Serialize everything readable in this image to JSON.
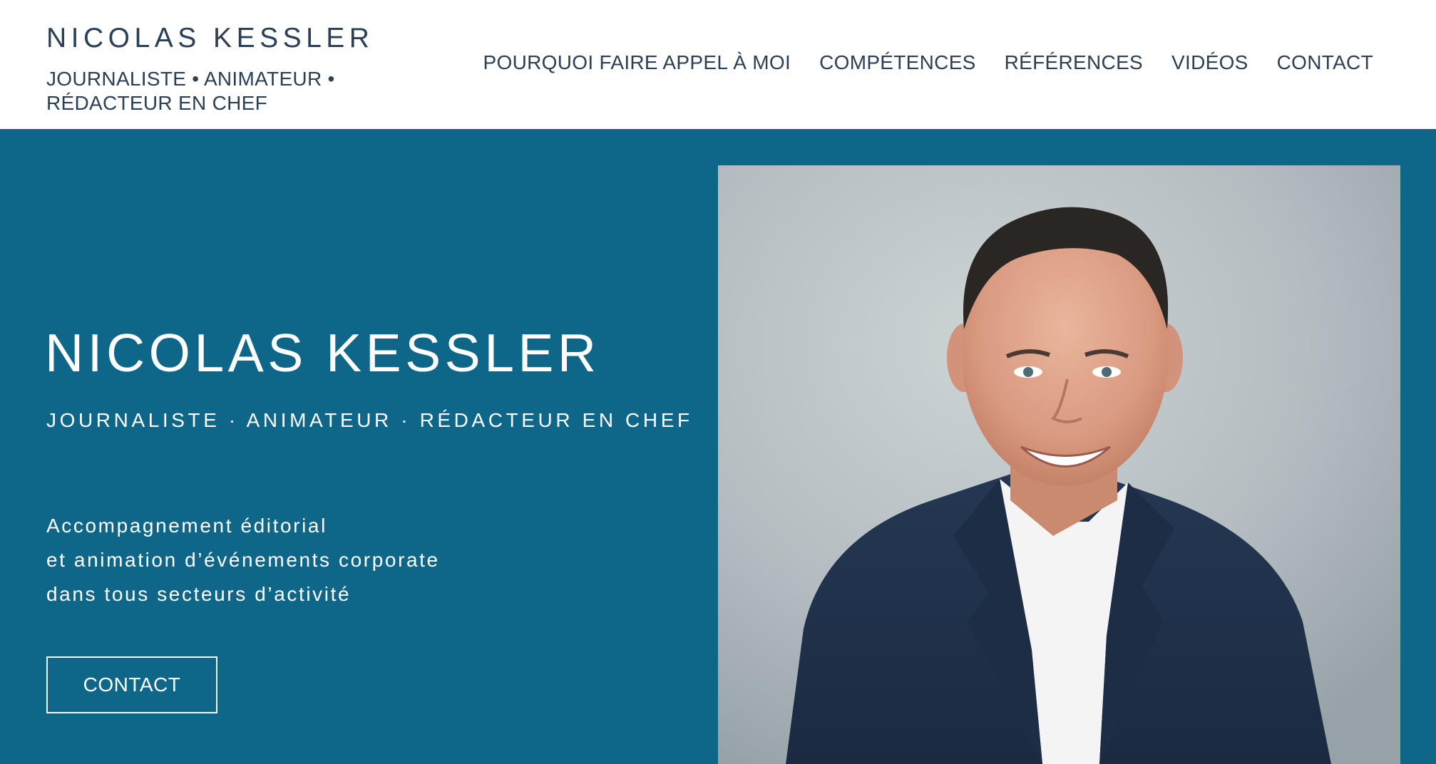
{
  "header": {
    "brand_name": "NICOLAS KESSLER",
    "brand_tagline": "JOURNALISTE • ANIMATEUR • RÉDACTEUR EN CHEF",
    "nav": [
      "POURQUOI FAIRE APPEL À MOI",
      "COMPÉTENCES",
      "RÉFÉRENCES",
      "VIDÉOS",
      "CONTACT"
    ]
  },
  "hero": {
    "title": "NICOLAS KESSLER",
    "subtitle": "JOURNALISTE · ANIMATEUR · RÉDACTEUR EN CHEF",
    "description": [
      "Accompagnement éditorial",
      "et animation d’événements corporate",
      "dans tous secteurs d’activité"
    ],
    "cta_label": "CONTACT"
  },
  "colors": {
    "brand_navy": "#2b3f55",
    "hero_background": "#0e6689",
    "header_background": "#ffffff",
    "text_light": "#ffffff"
  }
}
